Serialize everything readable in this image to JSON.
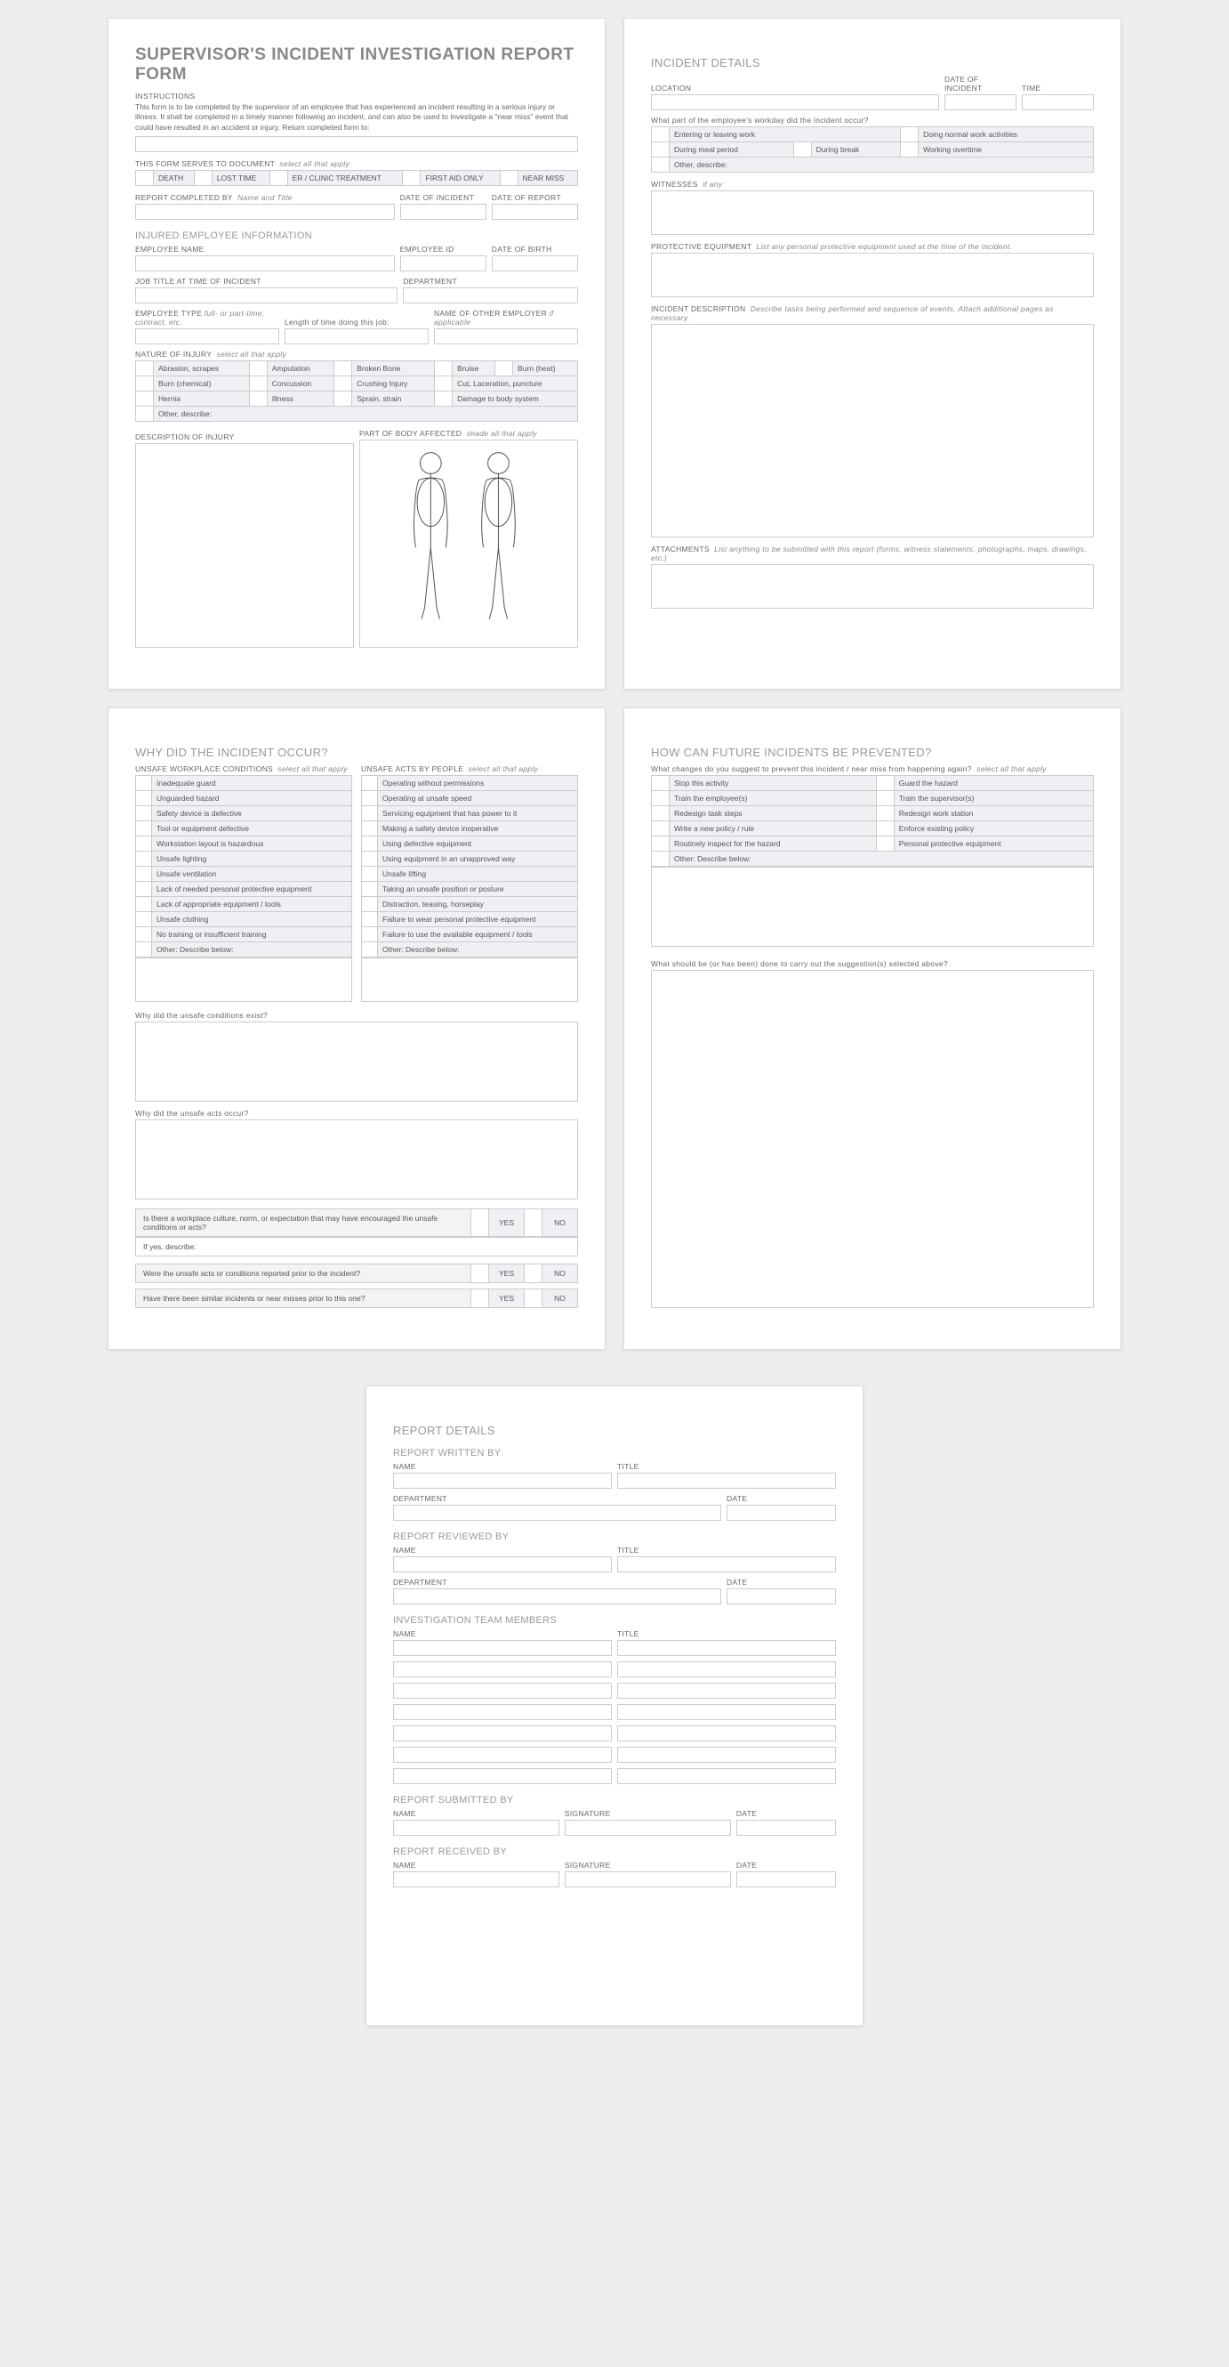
{
  "title": "SUPERVISOR'S INCIDENT INVESTIGATION REPORT FORM",
  "instructions": {
    "heading": "INSTRUCTIONS",
    "text": "This form is to be completed by the supervisor of an employee that has experienced an incident resulting in a serious injury or illness. It shall be completed in a timely manner following an incident, and can also be used to investigate a \"near miss\" event that could have resulted in an accident or injury. Return completed form to:"
  },
  "doc_purpose": {
    "label": "THIS FORM SERVES TO DOCUMENT",
    "hint": "select all that apply",
    "options": [
      "DEATH",
      "LOST TIME",
      "ER / CLINIC TREATMENT",
      "FIRST AID ONLY",
      "NEAR MISS"
    ]
  },
  "completed_by": {
    "label": "REPORT COMPLETED BY",
    "hint": "Name and Title",
    "date_incident": "DATE OF INCIDENT",
    "date_report": "DATE OF REPORT"
  },
  "employee": {
    "section": "INJURED EMPLOYEE INFORMATION",
    "name": "EMPLOYEE NAME",
    "id": "EMPLOYEE ID",
    "dob": "DATE OF BIRTH",
    "job_title": "JOB TITLE AT TIME OF INCIDENT",
    "department": "DEPARTMENT",
    "type_label": "EMPLOYEE TYPE",
    "type_hint": "full- or part-time, contract, etc.",
    "length": "Length of time doing this job:",
    "other_employer": "NAME OF OTHER EMPLOYER",
    "other_employer_hint": "if applicable"
  },
  "nature": {
    "label": "NATURE OF INJURY",
    "hint": "select all that apply",
    "options": [
      [
        "Abrasion, scrapes",
        "Amputation",
        "Broken Bone",
        "Bruise",
        "Burn (heat)"
      ],
      [
        "Burn (chemical)",
        "Concussion",
        "Crushing Injury",
        "Cut, Laceration, puncture"
      ],
      [
        "Hernia",
        "Illness",
        "Sprain, strain",
        "Damage to body system"
      ],
      [
        "Other, describe:"
      ]
    ]
  },
  "desc_injury": "DESCRIPTION OF INJURY",
  "body_part": {
    "label": "PART OF BODY AFFECTED",
    "hint": "shade all that apply"
  },
  "incident": {
    "section": "INCIDENT DETAILS",
    "location": "LOCATION",
    "date": "DATE OF INCIDENT",
    "time": "TIME",
    "workday_q": "What part of the employee's workday did the incident occur?",
    "workday_options": [
      [
        "Entering or leaving work",
        "Doing normal work activities"
      ],
      [
        "During meal period",
        "During break",
        "Working overtime"
      ],
      [
        "Other, describe:"
      ]
    ],
    "witnesses": "WITNESSES",
    "witnesses_hint": "if any",
    "ppe": "PROTECTIVE EQUIPMENT",
    "ppe_hint": "List any personal protective equipment used at the time of the incident.",
    "description": "INCIDENT DESCRIPTION",
    "description_hint": "Describe tasks being performed and sequence of events.  Attach additional pages as necessary.",
    "attachments": "ATTACHMENTS",
    "attachments_hint": "List anything to be submitted with this report (forms, witness statements, photographs, maps, drawings, etc.)"
  },
  "why": {
    "section": "WHY DID THE INCIDENT OCCUR?",
    "conditions_label": "UNSAFE WORKPLACE CONDITIONS",
    "acts_label": "UNSAFE ACTS BY PEOPLE",
    "hint": "select all that apply",
    "conditions": [
      "Inadequate guard",
      "Unguarded hazard",
      "Safety device is defective",
      "Tool or equipment defective",
      "Workstation layout is hazardous",
      "Unsafe lighting",
      "Unsafe ventilation",
      "Lack of needed personal protective equipment",
      "Lack of appropriate equipment / tools",
      "Unsafe clothing",
      "No training or insufficient training",
      "Other: Describe below:"
    ],
    "acts": [
      "Operating without permissions",
      "Operating at unsafe speed",
      "Servicing equipment that has power to it",
      "Making a safety device inoperative",
      "Using defective equipment",
      "Using equipment in an unapproved way",
      "Unsafe lifting",
      "Taking an unsafe position or posture",
      "Distraction, teasing, horseplay",
      "Failure to wear personal protective equipment",
      "Failure to use the available equipment / tools",
      "Other: Describe below:"
    ],
    "q_conditions_exist": "Why did the unsafe conditions exist?",
    "q_acts_occur": "Why did the unsafe acts occur?",
    "q_culture": "Is there a workplace culture, norm, or expectation that may have encouraged the unsafe conditions or acts?",
    "if_yes": "If yes, describe:",
    "q_reported": "Were the unsafe acts or conditions reported prior to the incident?",
    "q_similar": "Have there been similar incidents or near misses prior to this one?",
    "yes": "YES",
    "no": "NO"
  },
  "prevent": {
    "section": "HOW CAN FUTURE INCIDENTS BE PREVENTED?",
    "q": "What changes do you suggest to prevent this incident / near miss from happening again?",
    "hint": "select all that apply",
    "options": [
      [
        "Stop this activity",
        "Guard the hazard"
      ],
      [
        "Train the employee(s)",
        "Train the supervisor(s)"
      ],
      [
        "Redesign task steps",
        "Redesign work station"
      ],
      [
        "Write a new policy / rule",
        "Enforce existing policy"
      ],
      [
        "Routinely inspect for the hazard",
        "Personal protective equipment"
      ],
      [
        "Other: Describe below:"
      ]
    ],
    "q_done": "What should be (or has been) done to carry out the suggestion(s) selected above?"
  },
  "report": {
    "section": "REPORT DETAILS",
    "written_by": "REPORT WRITTEN BY",
    "reviewed_by": "REPORT REVIEWED BY",
    "team": "INVESTIGATION TEAM MEMBERS",
    "submitted_by": "REPORT SUBMITTED BY",
    "received_by": "REPORT RECEIVED BY",
    "name": "NAME",
    "title": "TITLE",
    "department": "DEPARTMENT",
    "date": "DATE",
    "signature": "SIGNATURE"
  }
}
